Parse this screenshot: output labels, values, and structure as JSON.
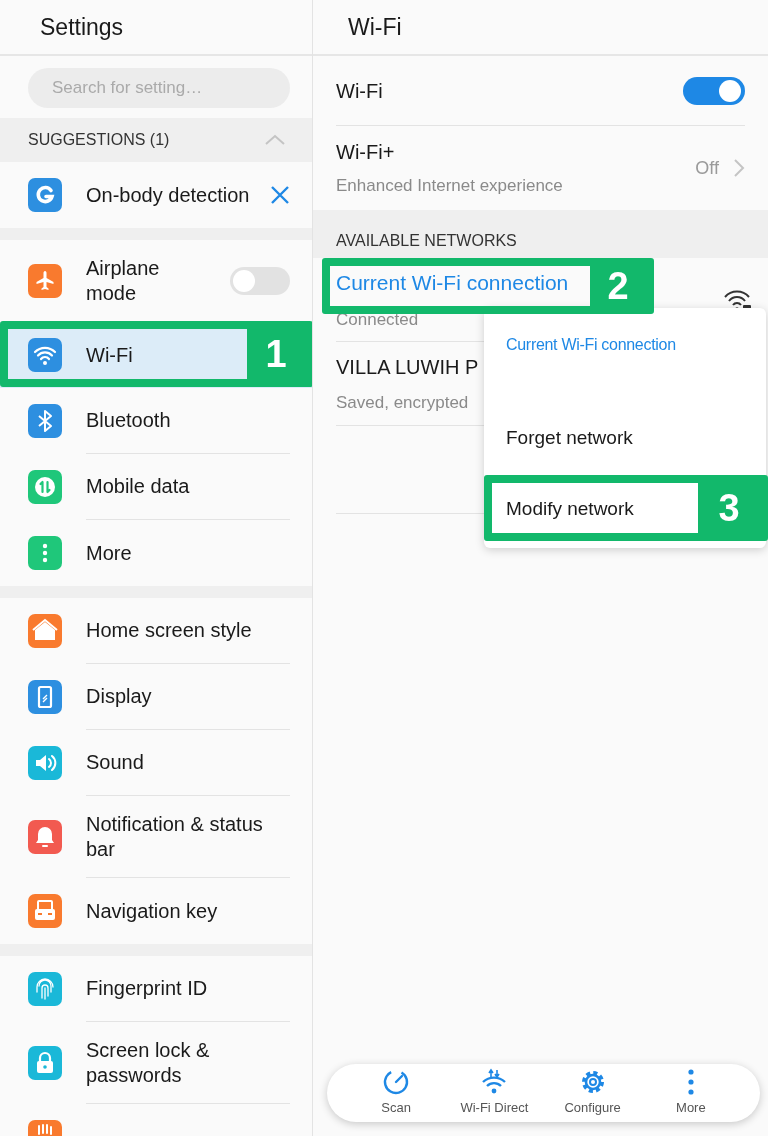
{
  "settings_pane": {
    "title": "Settings",
    "search": {
      "placeholder": "Search for setting…"
    },
    "suggestions": {
      "header": "SUGGESTIONS (1)",
      "expanded": true,
      "items": [
        {
          "label": "On-body detection"
        }
      ]
    },
    "groups": [
      [
        {
          "label": "Airplane mode",
          "kind": "toggle",
          "on": false,
          "selected": false
        },
        {
          "label": "Wi-Fi",
          "kind": "link",
          "selected": true,
          "callout": "1"
        },
        {
          "label": "Bluetooth",
          "kind": "link",
          "selected": false
        },
        {
          "label": "Mobile data",
          "kind": "link",
          "selected": false
        },
        {
          "label": "More",
          "kind": "link",
          "selected": false
        }
      ],
      [
        {
          "label": "Home screen style",
          "kind": "link",
          "selected": false
        },
        {
          "label": "Display",
          "kind": "link",
          "selected": false
        },
        {
          "label": "Sound",
          "kind": "link",
          "selected": false
        },
        {
          "label": "Notification & status bar",
          "kind": "link",
          "selected": false
        },
        {
          "label": "Navigation key",
          "kind": "link",
          "selected": false
        }
      ],
      [
        {
          "label": "Fingerprint ID",
          "kind": "link",
          "selected": false
        },
        {
          "label": "Screen lock & passwords",
          "kind": "link",
          "selected": false
        },
        {
          "kind": "link",
          "selected": false
        }
      ]
    ]
  },
  "wifi_pane": {
    "title": "Wi-Fi",
    "wifi_toggle": {
      "label": "Wi-Fi",
      "on": true
    },
    "wifi_plus": {
      "label": "Wi-Fi+",
      "subtitle": "Enhanced Internet experience",
      "value": "Off"
    },
    "section_header": "AVAILABLE NETWORKS",
    "networks": [
      {
        "name": "Current Wi-Fi connection",
        "status": "Connected",
        "current": true,
        "callout": "2"
      },
      {
        "name": "VILLA LUWIH P",
        "status": "Saved, encrypted",
        "current": false
      }
    ],
    "context_menu": {
      "title": "Current Wi-Fi connection",
      "items": [
        {
          "label": "Forget network"
        },
        {
          "label": "Modify network",
          "callout": "3"
        }
      ]
    },
    "toolbar": [
      {
        "label": "Scan"
      },
      {
        "label": "Wi-Fi Direct"
      },
      {
        "label": "Configure"
      },
      {
        "label": "More"
      }
    ]
  }
}
